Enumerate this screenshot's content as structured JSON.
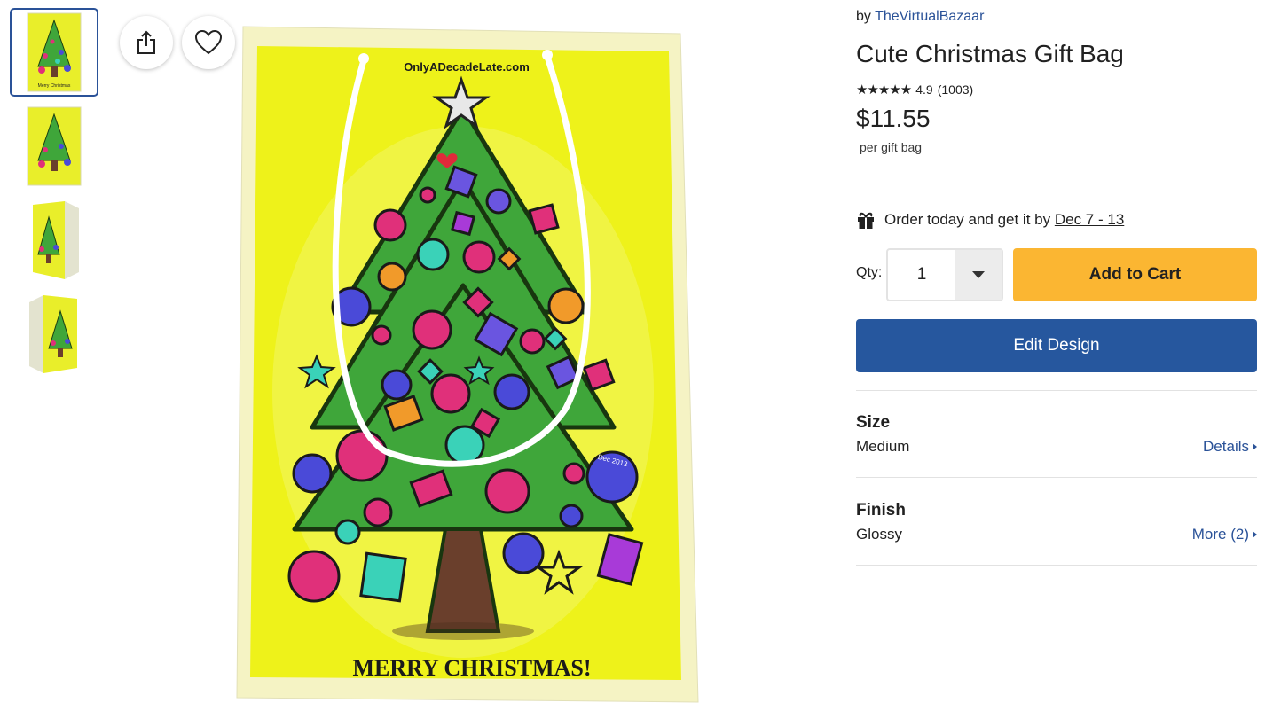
{
  "product": {
    "by_prefix": "by",
    "seller": "TheVirtualBazaar",
    "title": "Cute Christmas Gift Bag",
    "stars": "★★★★★",
    "rating": "4.9",
    "review_count": "(1003)",
    "price": "$11.55",
    "price_unit": "per gift bag"
  },
  "delivery": {
    "icon": "gift-icon",
    "text": "Order today and get it by",
    "dates": "Dec 7 - 13"
  },
  "cart": {
    "qty_label": "Qty:",
    "qty_value": "1",
    "add_to_cart_label": "Add to Cart",
    "edit_design_label": "Edit Design"
  },
  "options": {
    "size": {
      "title": "Size",
      "value": "Medium",
      "link": "Details"
    },
    "finish": {
      "title": "Finish",
      "value": "Glossy",
      "link": "More (2)"
    }
  },
  "image": {
    "site_text": "OnlyADecadeLate.com",
    "greeting": "MERRY CHRISTMAS!",
    "date_mark": "Dec 2013"
  },
  "thumbnails": [
    "front-view",
    "flat-view",
    "angle-view-left",
    "angle-view-right"
  ],
  "colors": {
    "accent_blue": "#26579e",
    "link_blue": "#2a5298",
    "cart_yellow": "#fbb632",
    "bag_yellow": "#eef21a",
    "tree_green": "#3fa63a"
  }
}
